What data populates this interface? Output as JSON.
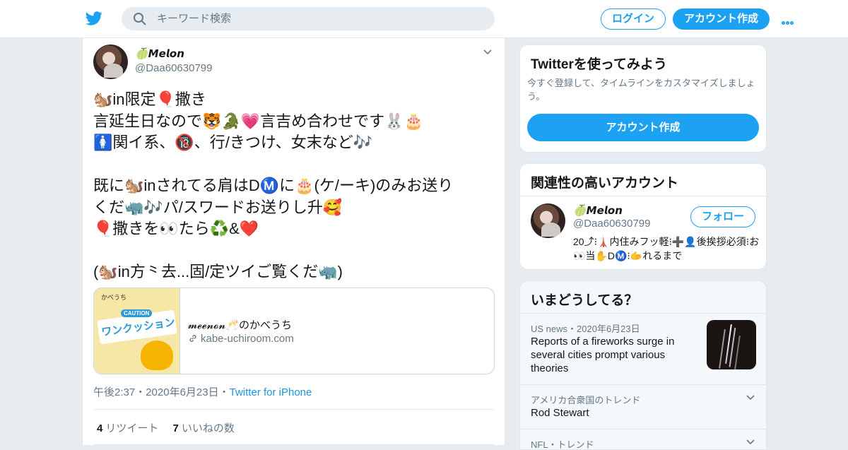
{
  "header": {
    "search_placeholder": "キーワード検索",
    "login_label": "ログイン",
    "signup_label": "アカウント作成"
  },
  "tweet": {
    "author_name": "🍈𝙈𝙚𝙡𝙤𝙣",
    "author_handle": "@Daa60630799",
    "text": "🐿️in限定🎈撒き\n言延生日なので🐯🐊💗言吉め合わせです🐰🎂\n🚺関イ系、🔞、行/きつけ、女末など🎶\n\n既に🐿️inされてる肩はDⓂ️に🎂(ケ/ーキ)のみお送り\nくだ🦏🎶パ/スワードお送りし升🥰\n🎈撒きを👀たら♻️&❤️\n\n(🐿️in方⺀去...固/定ツイご覧くだ🦏)",
    "card": {
      "image_heading": "かべうち",
      "image_badge": "CAUTION",
      "image_word": "ワンクッション",
      "title": "𝓶𝓮𝓮𝓷𝓸𝓷🥂のかべうち",
      "url": "kabe-uchiroom.com"
    },
    "time": "午後2:37",
    "date": "2020年6月23日",
    "source": "Twitter for iPhone",
    "retweet_count": "4",
    "retweet_label": "リツイート",
    "like_count": "7",
    "like_label": "いいねの数"
  },
  "sidebar": {
    "signup_panel": {
      "title": "Twitterを使ってみよう",
      "subtitle": "今すぐ登録して、タイムラインをカスタマイズしましょう。",
      "button": "アカウント作成"
    },
    "related": {
      "title": "関連性の高いアカウント",
      "name": "🍈𝙈𝙚𝙡𝙤𝙣",
      "handle": "@Daa60630799",
      "follow_label": "フォロー",
      "bio": "20⤴︎⁝🗼内住みフッ軽⁝➕👤後挨拶必須⁝お👀当✋DⓂ️⁝🫱れるまで"
    },
    "trends": {
      "title": "いまどうしてる？",
      "items": [
        {
          "meta": "US news・2020年6月23日",
          "title": "Reports of a fireworks surge in several cities prompt various theories"
        },
        {
          "meta": "アメリカ合衆国のトレンド",
          "title": "Rod Stewart"
        },
        {
          "meta": "NFL・トレンド",
          "title": ""
        }
      ]
    }
  },
  "colors": {
    "accent": "#1da1f2",
    "background": "#e6ecf0",
    "secondary_text": "#657786"
  }
}
